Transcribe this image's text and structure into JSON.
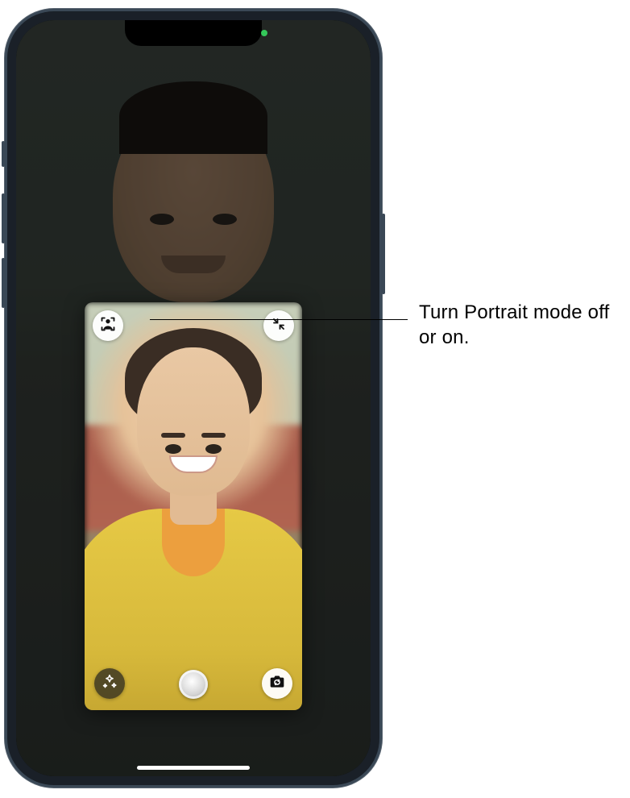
{
  "callout": {
    "text": "Turn Portrait mode off or on."
  },
  "controls": {
    "portrait_mode": "portrait-mode-icon",
    "minimize": "minimize-icon",
    "effects": "effects-icon",
    "shutter": "shutter-button",
    "flip_camera": "flip-camera-icon"
  },
  "status": {
    "camera_indicator": "active"
  }
}
